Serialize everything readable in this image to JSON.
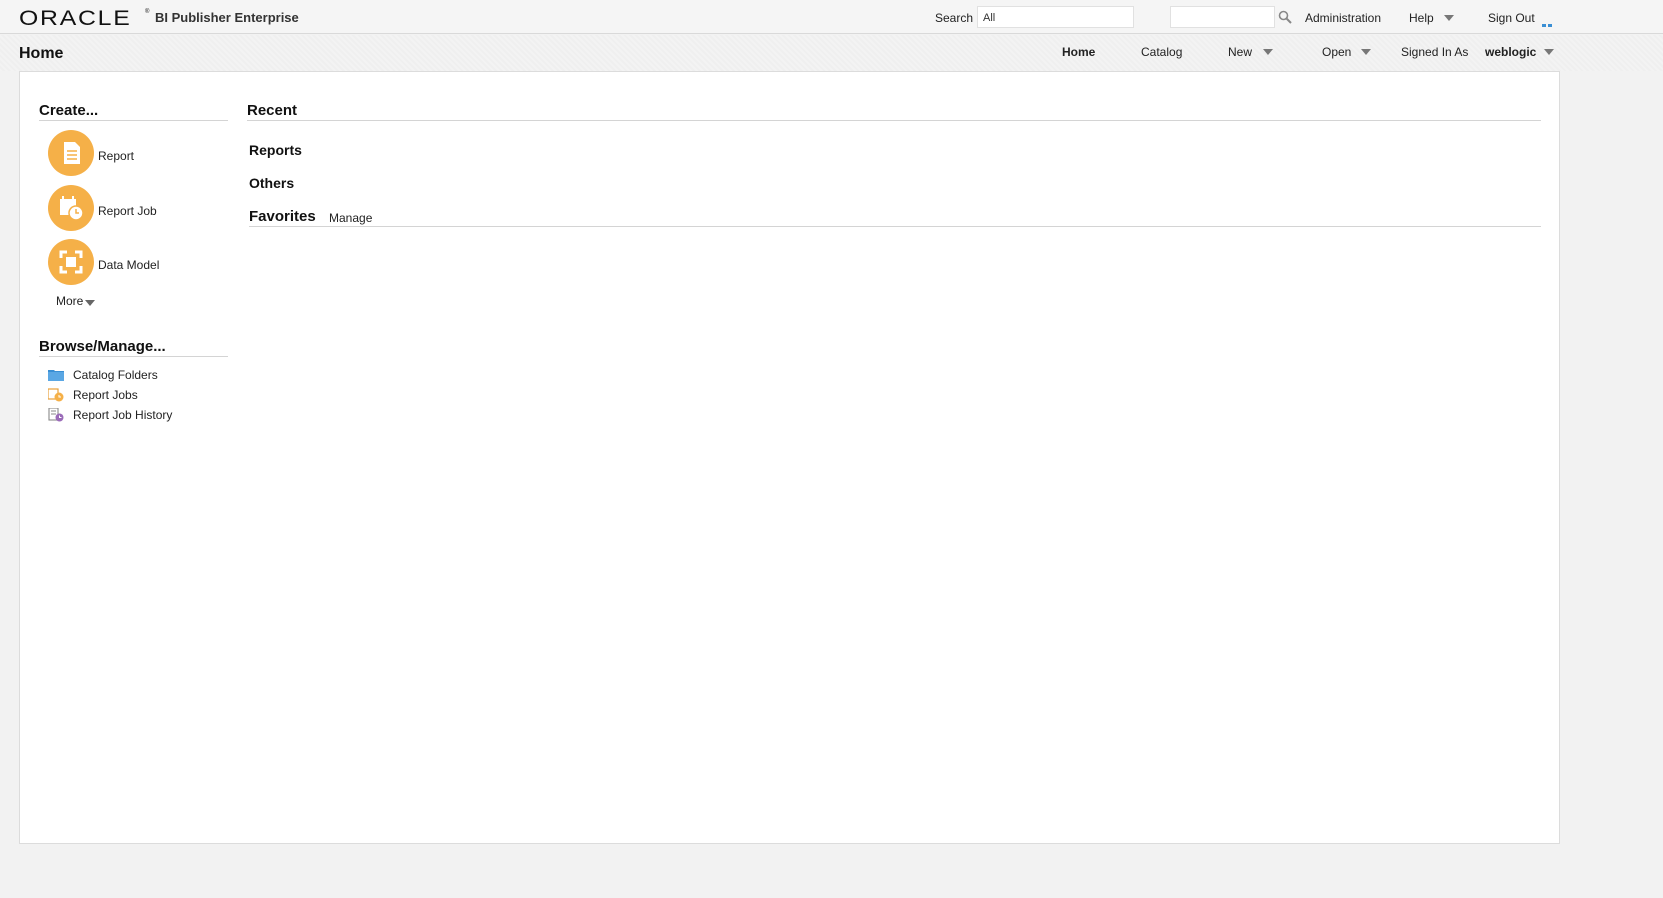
{
  "header": {
    "logo_text": "ORACLE",
    "logo_mark": "®",
    "product_name": "BI Publisher Enterprise",
    "search_label": "Search",
    "search_scope": "All",
    "search_placeholder": "",
    "links": {
      "administration": "Administration",
      "help": "Help",
      "sign_out": "Sign Out"
    }
  },
  "nav": {
    "page_title": "Home",
    "home": "Home",
    "catalog": "Catalog",
    "new": "New",
    "open": "Open",
    "signed_in_as": "Signed In As",
    "username": "weblogic"
  },
  "create": {
    "title": "Create...",
    "items": [
      {
        "label": "Report",
        "icon": "report-document-icon"
      },
      {
        "label": "Report Job",
        "icon": "report-job-calendar-icon"
      },
      {
        "label": "Data Model",
        "icon": "data-model-icon"
      }
    ],
    "more": "More"
  },
  "browse": {
    "title": "Browse/Manage...",
    "items": [
      {
        "label": "Catalog Folders",
        "icon": "folder-icon"
      },
      {
        "label": "Report Jobs",
        "icon": "report-jobs-icon"
      },
      {
        "label": "Report Job History",
        "icon": "report-job-history-icon"
      }
    ]
  },
  "recent": {
    "title": "Recent",
    "reports": "Reports",
    "others": "Others"
  },
  "favorites": {
    "title": "Favorites",
    "manage": "Manage"
  },
  "colors": {
    "accent_orange": "#f5b048",
    "folder_blue": "#3a8fd4",
    "history_purple": "#9a6bb8"
  }
}
